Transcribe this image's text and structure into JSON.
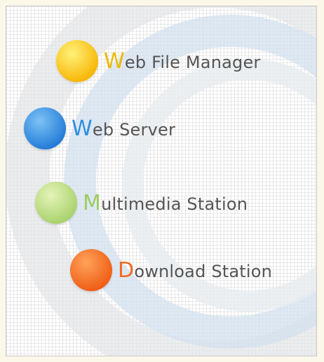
{
  "menu": {
    "items": [
      {
        "id": "web-file-manager",
        "initial": "W",
        "rest": "eb File Manager",
        "accent": "#f0b800",
        "bubble_light": "#fff27a",
        "bubble_dark": "#f7b300"
      },
      {
        "id": "web-server",
        "initial": "W",
        "rest": "eb Server",
        "accent": "#2f8fe0",
        "bubble_light": "#7cc3f5",
        "bubble_dark": "#1f78d6"
      },
      {
        "id": "multimedia-station",
        "initial": "M",
        "rest": "ultimedia Station",
        "accent": "#9ccc60",
        "bubble_light": "#e4f4b8",
        "bubble_dark": "#a6d06a"
      },
      {
        "id": "download-station",
        "initial": "D",
        "rest": "ownload Station",
        "accent": "#f26a22",
        "bubble_light": "#ffa25a",
        "bubble_dark": "#ef5a12"
      }
    ]
  }
}
